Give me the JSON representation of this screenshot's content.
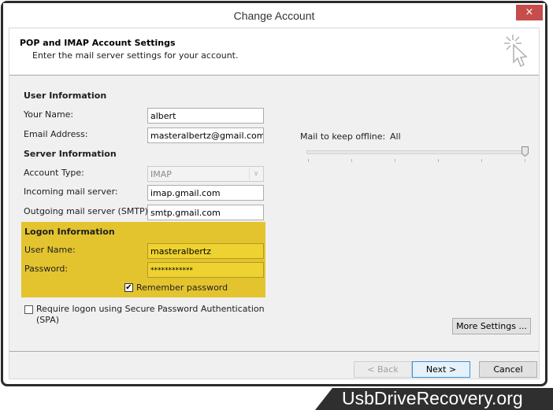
{
  "window": {
    "title": "Change Account",
    "close_label": "×"
  },
  "header": {
    "title": "POP and IMAP Account Settings",
    "subtitle": "Enter the mail server settings for your account.",
    "icon": "cursor-click-icon"
  },
  "user_info": {
    "section_label": "User Information",
    "your_name_label": "Your Name:",
    "your_name_value": "albert",
    "email_label": "Email Address:",
    "email_value": "masteralbertz@gmail.com"
  },
  "server_info": {
    "section_label": "Server Information",
    "account_type_label": "Account Type:",
    "account_type_value": "IMAP",
    "incoming_label": "Incoming mail server:",
    "incoming_value": "imap.gmail.com",
    "outgoing_label": "Outgoing mail server (SMTP):",
    "outgoing_value": "smtp.gmail.com"
  },
  "logon_info": {
    "section_label": "Logon Information",
    "highlight_color": "#e3c42f",
    "username_label": "User Name:",
    "username_value": "masteralbertz",
    "password_label": "Password:",
    "password_value": "************",
    "remember_label": "Remember password",
    "remember_checked": true
  },
  "spa": {
    "label_line1": "Require logon using Secure Password Authentication",
    "label_line2": "(SPA)",
    "checked": false
  },
  "offline": {
    "label": "Mail to keep offline:",
    "value": "All",
    "slider_position_fraction": 1.0,
    "tick_count": 6
  },
  "buttons": {
    "more_settings": "More Settings ...",
    "back": "< Back",
    "next": "Next >",
    "cancel": "Cancel"
  },
  "watermark": {
    "text": "UsbDriveRecovery.org"
  }
}
